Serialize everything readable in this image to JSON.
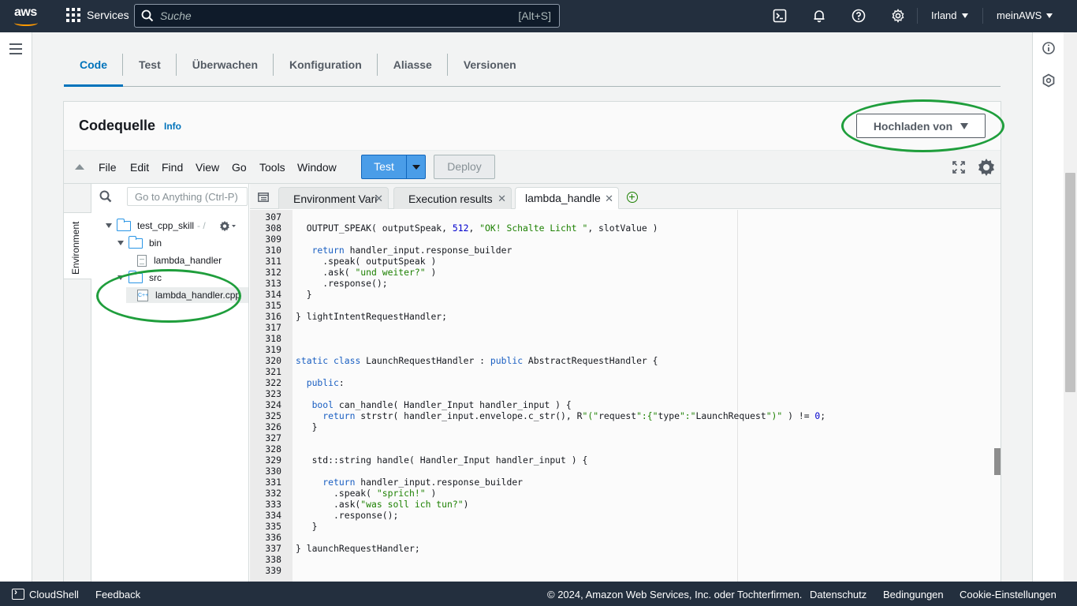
{
  "topbar": {
    "logo": "aws",
    "services_label": "Services",
    "search_placeholder": "Suche",
    "search_shortcut": "[Alt+S]",
    "region": "Irland",
    "account": "meinAWS",
    "icons": [
      "cloudshell-icon",
      "bell-icon",
      "help-icon",
      "settings-icon"
    ]
  },
  "tabs": [
    "Code",
    "Test",
    "Überwachen",
    "Konfiguration",
    "Aliasse",
    "Versionen"
  ],
  "panel": {
    "title": "Codequelle",
    "info": "Info",
    "upload_label": "Hochladen von"
  },
  "ide": {
    "menu": [
      "File",
      "Edit",
      "Find",
      "View",
      "Go",
      "Tools",
      "Window"
    ],
    "test_label": "Test",
    "deploy_label": "Deploy",
    "env_tab": "Environment",
    "tree_search_placeholder": "Go to Anything (Ctrl-P)",
    "tree": {
      "root": "test_cpp_skill",
      "root_suffix": "- /",
      "bin": "bin",
      "bin_file": "lambda_handler",
      "src": "src",
      "src_file": "lambda_handler.cpp"
    },
    "editor_tabs": [
      "Environment Vari",
      "Execution results",
      "lambda_handler"
    ]
  },
  "code": [
    {
      "n": "307",
      "t": ""
    },
    {
      "n": "308",
      "t": "  OUTPUT_SPEAK( outputSpeak, 512, \"OK! Schalte Licht \", slotValue )"
    },
    {
      "n": "309",
      "t": ""
    },
    {
      "n": "310",
      "t": "   return handler_input.response_builder"
    },
    {
      "n": "311",
      "t": "     .speak( outputSpeak )"
    },
    {
      "n": "312",
      "t": "     .ask( \"und weiter?\" )"
    },
    {
      "n": "313",
      "t": "     .response();"
    },
    {
      "n": "314",
      "t": "  }"
    },
    {
      "n": "315",
      "t": ""
    },
    {
      "n": "316",
      "t": "} lightIntentRequestHandler;"
    },
    {
      "n": "317",
      "t": ""
    },
    {
      "n": "318",
      "t": ""
    },
    {
      "n": "319",
      "t": ""
    },
    {
      "n": "320",
      "t": "static class LaunchRequestHandler : public AbstractRequestHandler {"
    },
    {
      "n": "321",
      "t": ""
    },
    {
      "n": "322",
      "t": "  public:"
    },
    {
      "n": "323",
      "t": ""
    },
    {
      "n": "324",
      "t": "   bool can_handle( Handler_Input handler_input ) {"
    },
    {
      "n": "325",
      "t": "     return strstr( handler_input.envelope.c_str(), R\"(\"request\":{\"type\":\"LaunchRequest\")\" ) != 0;"
    },
    {
      "n": "326",
      "t": "   }"
    },
    {
      "n": "327",
      "t": ""
    },
    {
      "n": "328",
      "t": ""
    },
    {
      "n": "329",
      "t": "   std::string handle( Handler_Input handler_input ) {"
    },
    {
      "n": "330",
      "t": ""
    },
    {
      "n": "331",
      "t": "     return handler_input.response_builder"
    },
    {
      "n": "332",
      "t": "       .speak( \"sprich!\" )"
    },
    {
      "n": "333",
      "t": "       .ask(\"was soll ich tun?\")"
    },
    {
      "n": "334",
      "t": "       .response();"
    },
    {
      "n": "335",
      "t": "   }"
    },
    {
      "n": "336",
      "t": ""
    },
    {
      "n": "337",
      "t": "} launchRequestHandler;"
    },
    {
      "n": "338",
      "t": ""
    },
    {
      "n": "339",
      "t": ""
    }
  ],
  "footer": {
    "cloudshell": "CloudShell",
    "feedback": "Feedback",
    "copyright": "© 2024, Amazon Web Services, Inc. oder Tochterfirmen.",
    "privacy": "Datenschutz",
    "terms": "Bedingungen",
    "cookies": "Cookie-Einstellungen"
  },
  "colors": {
    "topbar": "#232f3e",
    "accent": "#0073bb",
    "run_button": "#4a9de8",
    "annotation": "#1f9e3c"
  }
}
